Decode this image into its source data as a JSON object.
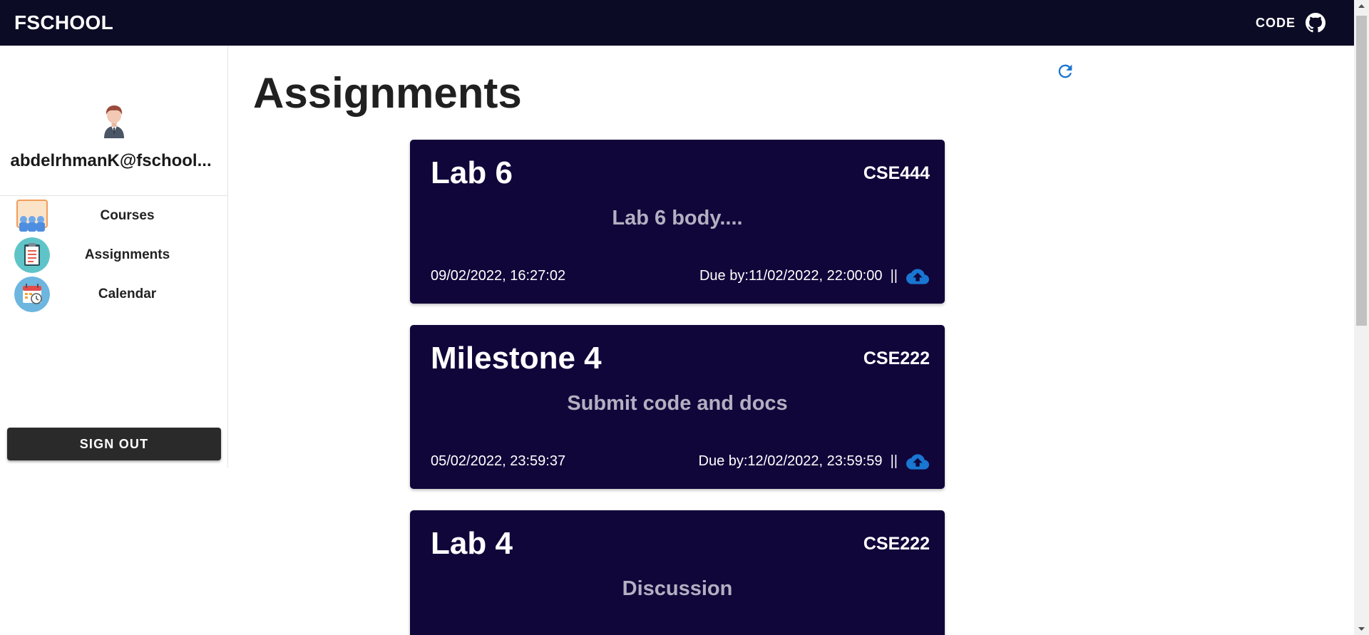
{
  "header": {
    "brand": "FSCHOOL",
    "code_label": "CODE",
    "code_icon": "github-icon"
  },
  "sidebar": {
    "email": "abdelrhmanK@fschool...",
    "items": [
      {
        "label": "Courses",
        "icon": "courses-icon"
      },
      {
        "label": "Assignments",
        "icon": "assignments-icon"
      },
      {
        "label": "Calendar",
        "icon": "calendar-icon"
      }
    ],
    "signout_label": "SIGN OUT"
  },
  "main": {
    "title": "Assignments",
    "assignments": [
      {
        "title": "Lab 6",
        "course": "CSE444",
        "body": "Lab 6 body....",
        "created": "09/02/2022, 16:27:02",
        "due": "Due by:11/02/2022, 22:00:00  ||"
      },
      {
        "title": "Milestone 4",
        "course": "CSE222",
        "body": "Submit code and docs",
        "created": "05/02/2022, 23:59:37",
        "due": "Due by:12/02/2022, 23:59:59  ||"
      },
      {
        "title": "Lab 4",
        "course": "CSE222",
        "body": "Discussion",
        "created": "",
        "due": ""
      }
    ]
  },
  "colors": {
    "topbar": "#0b0b25",
    "card": "#11063a",
    "accent": "#1976d2",
    "signout": "#2a2a2a"
  }
}
